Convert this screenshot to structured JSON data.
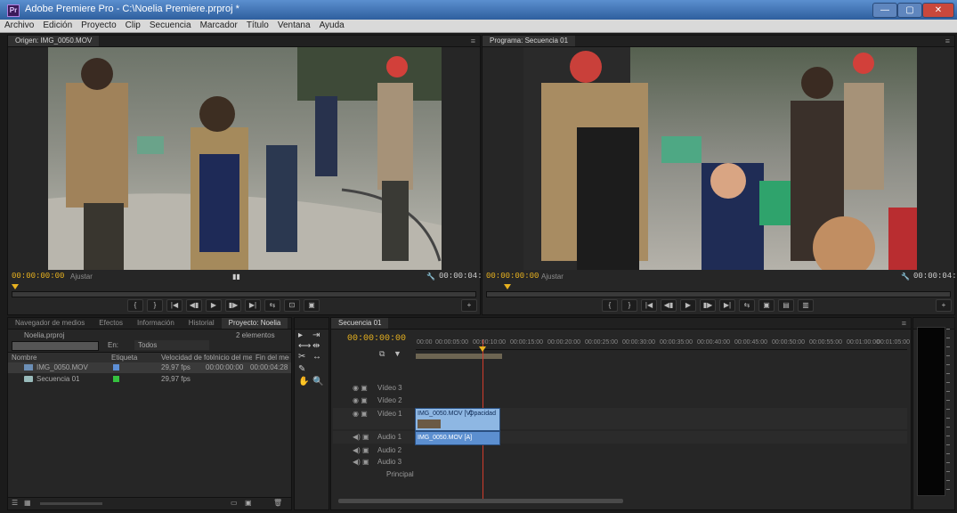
{
  "window": {
    "title": "Adobe Premiere Pro - C:\\Noelia Premiere.prproj *",
    "app_icon": "Pr",
    "controls": [
      "—",
      "▢",
      "✕"
    ]
  },
  "menubar": [
    "Archivo",
    "Edición",
    "Proyecto",
    "Clip",
    "Secuencia",
    "Marcador",
    "Título",
    "Ventana",
    "Ayuda"
  ],
  "source_monitor": {
    "tab": "Origen: IMG_0050.MOV",
    "timecode_left": "00:00:00:00",
    "fit_label": "Ajustar",
    "timecode_right": "00:00:04:28",
    "controls": [
      "{",
      "}",
      "|◀",
      "◀▮",
      "▶",
      "▮▶",
      "▶|",
      "⇆",
      "⊡",
      "▣",
      "+"
    ]
  },
  "program_monitor": {
    "tab": "Programa: Secuencia 01",
    "timecode_left": "00:00:00:00",
    "fit_label": "Ajustar",
    "timecode_right": "00:00:04:28",
    "controls": [
      "{",
      "}",
      "|◀",
      "◀▮",
      "▶",
      "▮▶",
      "▶|",
      "⇆",
      "▣",
      "▤",
      "▥",
      "+"
    ]
  },
  "project_panel": {
    "tabs": [
      "Navegador de medios",
      "Efectos",
      "Información",
      "Historial",
      "Proyecto: Noelia"
    ],
    "project_name": "Noelia.prproj",
    "item_count": "2 elementos",
    "search_placeholder": "En:",
    "in_filter": "Todos",
    "columns": [
      "Nombre",
      "Etiqueta",
      "Velocidad de fotogramas",
      "Inicio del medio",
      "Fin del medio"
    ],
    "items": [
      {
        "name": "IMG_0050.MOV",
        "rate": "29,97 fps",
        "start": "00:00:00:00",
        "end": "00:00:04:28",
        "label_color": "#5d8fd6"
      },
      {
        "name": "Secuencia 01",
        "rate": "29,97 fps",
        "start": "",
        "end": "",
        "label_color": "#35c23f"
      }
    ]
  },
  "tools_panel": {
    "tools": [
      "▸",
      "⇥",
      "⟷",
      "⇹",
      "✂",
      "↔",
      "✎",
      "✋",
      "🔍"
    ]
  },
  "timeline": {
    "tab": "Secuencia 01",
    "timecode": "00:00:00:00",
    "ruler": [
      "00:00",
      "00:00:05:00",
      "00:00:10:00",
      "00:00:15:00",
      "00:00:20:00",
      "00:00:25:00",
      "00:00:30:00",
      "00:00:35:00",
      "00:00:40:00",
      "00:00:45:00",
      "00:00:50:00",
      "00:00:55:00",
      "00:01:00:00",
      "00:01:05:00"
    ],
    "tracks": [
      {
        "name": "Vídeo 3"
      },
      {
        "name": "Vídeo 2"
      },
      {
        "name": "Vídeo 1"
      },
      {
        "name": "Audio 1"
      },
      {
        "name": "Audio 2"
      },
      {
        "name": "Audio 3"
      },
      {
        "name": "Principal"
      }
    ],
    "video_clip": "IMG_0050.MOV [V]",
    "video_clip_extra": "Opacidad",
    "audio_clip": "IMG_0050.MOV [A]"
  },
  "colors": {
    "timecode": "#e8b21f",
    "video_clip": "#8eb7e3",
    "audio_clip": "#5c8fd0",
    "playhead": "#d13c2c"
  }
}
